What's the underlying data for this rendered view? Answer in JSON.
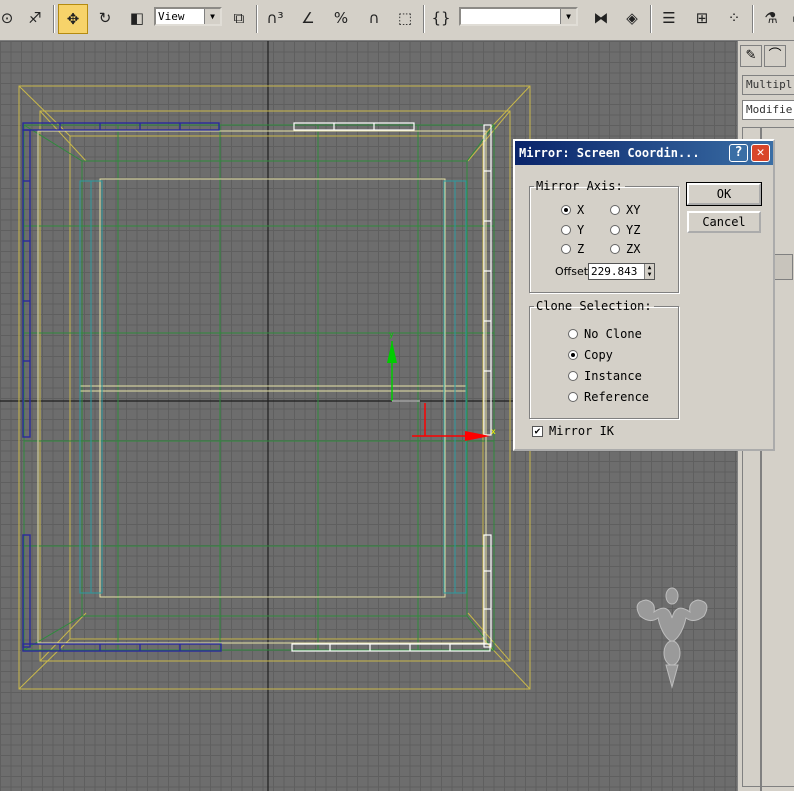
{
  "toolbar": {
    "view_combo_value": "View",
    "selection_set_value": "",
    "icons": [
      "select-icon",
      "link-icon",
      "move-icon",
      "rotate-icon",
      "scale-icon",
      "coordinate-combo",
      "pivot-icon",
      "snap-icon",
      "angle-snap-icon",
      "percent-snap-icon",
      "spinner-snap-icon",
      "named-selection-icon",
      "edit-named-selection-icon",
      "mirror-icon",
      "align-icon",
      "layer-manager-icon",
      "curve-editor-icon",
      "schematic-view-icon",
      "material-editor-icon",
      "render-setup-icon"
    ]
  },
  "command_panel": {
    "modifier_field_1": "Multipl",
    "modifier_field_2": "Modifier Li"
  },
  "dialog": {
    "title": "Mirror: Screen Coordin...",
    "help_glyph": "?",
    "close_glyph": "✕",
    "mirror_axis": {
      "legend": "Mirror Axis:",
      "options": [
        "X",
        "Y",
        "Z",
        "XY",
        "YZ",
        "ZX"
      ],
      "selected": "X",
      "offset_label": "Offset:",
      "offset_value": "229.843"
    },
    "clone_selection": {
      "legend": "Clone Selection:",
      "options": [
        "No Clone",
        "Copy",
        "Instance",
        "Reference"
      ],
      "selected": "Copy"
    },
    "mirror_ik": {
      "label": "Mirror IK",
      "checked": true
    },
    "ok_label": "OK",
    "cancel_label": "Cancel"
  },
  "colors": {
    "titlebar_start": "#0a246a",
    "titlebar_end": "#3a6ea5",
    "toolbar_bg": "#d4d0c8",
    "viewport_bg": "#6d6d6d",
    "active_tool": "#f7d36a",
    "wire_yellow": "#c9b84a",
    "wire_green": "#2e8b3c",
    "wire_white": "#ffffff",
    "wire_blue": "#2a2a9c",
    "gizmo_x": "#ff0000",
    "gizmo_y": "#00cc00"
  }
}
